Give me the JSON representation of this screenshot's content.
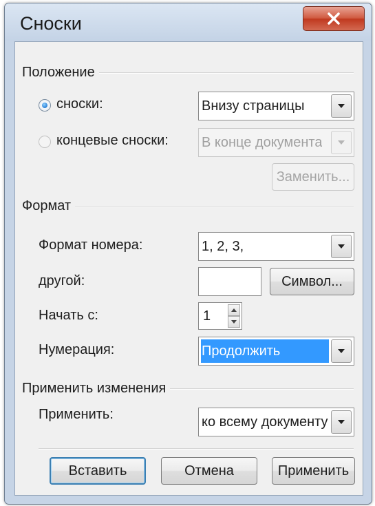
{
  "window": {
    "title": "Сноски"
  },
  "position": {
    "group_label": "Положение",
    "footnotes_label": "сноски:",
    "footnotes_value": "Внизу страницы",
    "endnotes_label": "концевые сноски:",
    "endnotes_value": "В конце документа",
    "convert_button": "Заменить..."
  },
  "format": {
    "group_label": "Формат",
    "number_format_label": "Формат номера:",
    "number_format_value": "1, 2, 3,",
    "custom_mark_label": "другой:",
    "custom_mark_value": "",
    "symbol_button": "Символ...",
    "start_at_label": "Начать с:",
    "start_at_value": "1",
    "numbering_label": "Нумерация:",
    "numbering_value": "Продолжить"
  },
  "apply_changes": {
    "group_label": "Применить изменения",
    "apply_to_label": "Применить:",
    "apply_to_value": "ко всему документу"
  },
  "buttons": {
    "insert": "Вставить",
    "cancel": "Отмена",
    "apply": "Применить"
  }
}
